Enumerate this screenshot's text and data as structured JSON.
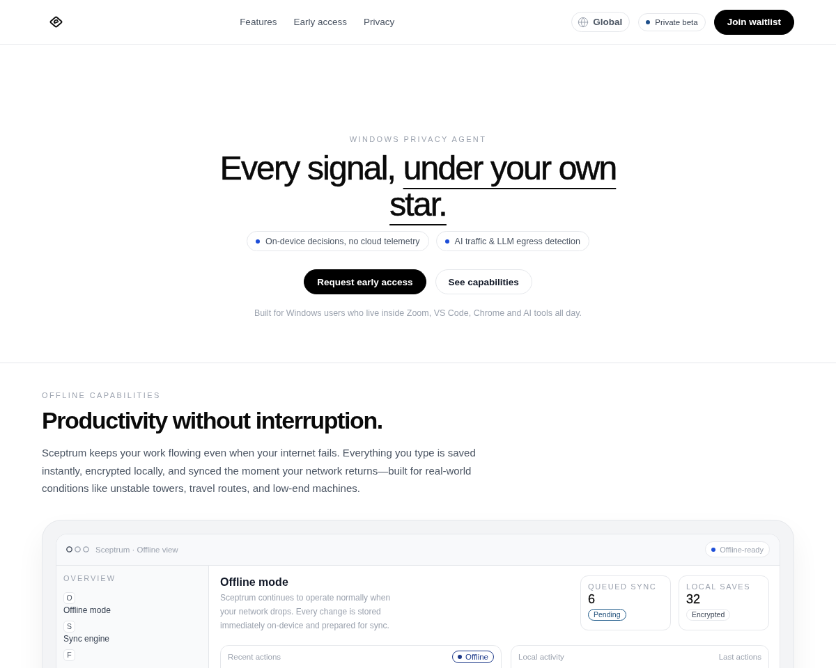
{
  "header": {
    "nav": [
      {
        "label": "Features"
      },
      {
        "label": "Early access"
      },
      {
        "label": "Privacy"
      }
    ],
    "region": "Global",
    "status": "Private beta",
    "cta": "Join waitlist"
  },
  "hero": {
    "eyebrow": "WINDOWS PRIVACY AGENT",
    "title_lead": "Every signal,",
    "title_emphasis": "under your own star.",
    "chips": [
      {
        "label": "On-device decisions, no cloud telemetry"
      },
      {
        "label": "AI traffic & LLM egress detection"
      }
    ],
    "actions": [
      {
        "label": "Request early access",
        "kind": "primary"
      },
      {
        "label": "See capabilities",
        "kind": "secondary"
      }
    ],
    "note": "Built for Windows users who live inside Zoom, VS Code, Chrome and AI tools all day."
  },
  "offline": {
    "eyebrow": "OFFLINE CAPABILITIES",
    "title": "Productivity without interruption.",
    "body": "Sceptrum keeps your work flowing even when your internet fails. Everything you type is saved instantly, encrypted locally, and synced the moment your network returns—built for real-world conditions like unstable towers, travel routes, and low-end machines.",
    "preview": {
      "window_title": "Sceptrum · Offline view",
      "status": "Offline-ready",
      "sidebar": {
        "heading": "OVERVIEW",
        "items": [
          {
            "initial": "O",
            "label": "Offline mode"
          },
          {
            "initial": "S",
            "label": "Sync engine"
          },
          {
            "initial": "F"
          }
        ]
      },
      "main": {
        "title": "Offline mode",
        "description": "Sceptrum continues to operate normally when your network drops. Every change is stored immediately on-device and prepared for sync.",
        "stats": [
          {
            "label": "QUEUED SYNC",
            "value": "6",
            "badge": "Pending",
            "kind": "accent"
          },
          {
            "label": "LOCAL SAVES",
            "value": "32",
            "badge": "Encrypted",
            "kind": "neutral"
          }
        ],
        "panels": [
          {
            "title": "Recent actions",
            "tag": "Offline",
            "kind": "badge"
          },
          {
            "title": "Local activity",
            "tag": "Last actions",
            "kind": "text"
          }
        ]
      }
    }
  }
}
